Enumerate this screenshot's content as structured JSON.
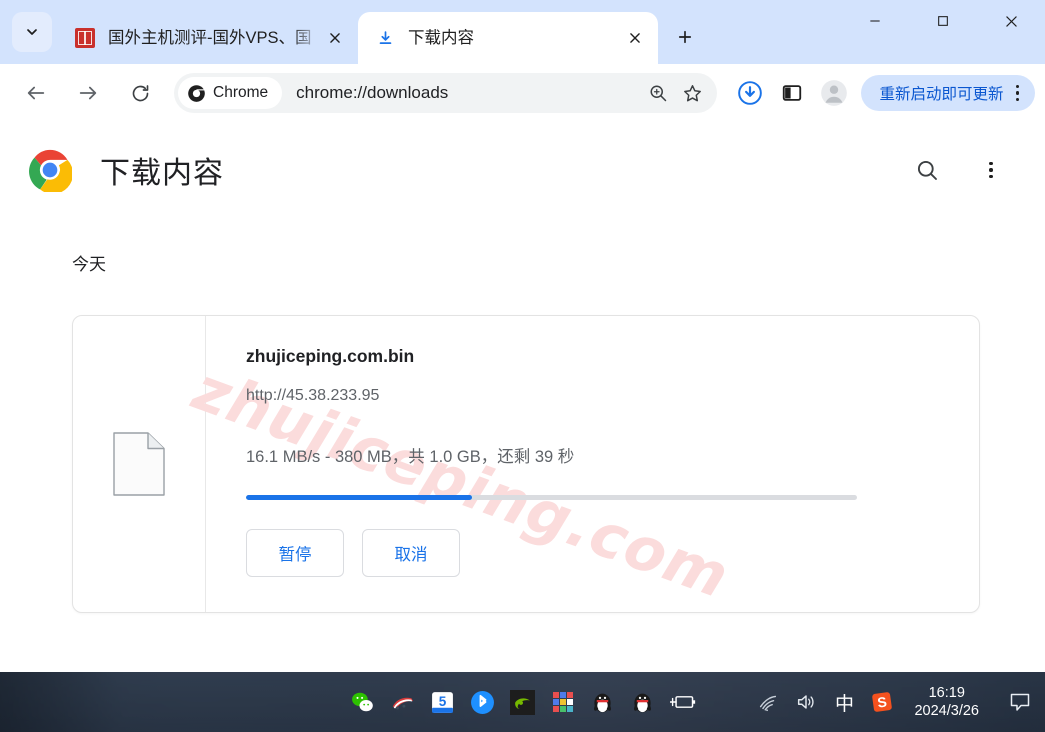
{
  "window": {
    "tabsearch_icon": "chevron-down-icon",
    "minimize_label": "—",
    "maximize_label": "□",
    "close_label": "✕",
    "newtab_label": "+"
  },
  "tabs": [
    {
      "title": "国外主机测评-国外VPS、国",
      "favicon": "red-stamp-favicon",
      "active": false,
      "close_label": "✕"
    },
    {
      "title": "下载内容",
      "favicon": "download-icon",
      "active": true,
      "close_label": "✕"
    }
  ],
  "toolbar": {
    "back_icon": "back-arrow-icon",
    "forward_icon": "forward-arrow-icon",
    "reload_icon": "reload-icon",
    "chrome_chip_label": "Chrome",
    "url": "chrome://downloads",
    "zoom_icon": "zoom-in-icon",
    "bookmark_icon": "star-icon",
    "downloads_icon": "downloads-ring-icon",
    "sidepanel_icon": "side-panel-icon",
    "profile_icon": "avatar-icon",
    "update_label": "重新启动即可更新",
    "menu_icon": "three-dot-menu-icon"
  },
  "page": {
    "logo": "chrome-logo",
    "title": "下载内容",
    "search_icon": "search-icon",
    "menu_icon": "three-dot-menu-icon",
    "group_label": "今天",
    "watermark": "zhujiceping.com"
  },
  "download": {
    "file_icon": "generic-file-icon",
    "file_name": "zhujiceping.com.bin",
    "url": "http://45.38.233.95",
    "status": "16.1 MB/s - 380 MB，共 1.0 GB，还剩 39 秒",
    "progress_percent": 37,
    "progress_fill_color": "#1a73e8",
    "pause_label": "暂停",
    "cancel_label": "取消"
  },
  "taskbar": {
    "apps": [
      {
        "name": "wechat-icon"
      },
      {
        "name": "train-ticket-icon"
      },
      {
        "name": "360-browser-icon",
        "label": "5"
      },
      {
        "name": "bluetooth-icon"
      },
      {
        "name": "nvidia-icon"
      },
      {
        "name": "color-squares-icon"
      },
      {
        "name": "qq-icon"
      },
      {
        "name": "qq-icon-2"
      },
      {
        "name": "battery-icon"
      }
    ],
    "tray": {
      "wifi_icon": "wifi-icon",
      "volume_icon": "volume-icon",
      "ime_label": "中",
      "sogou_label": "S",
      "time": "16:19",
      "date": "2024/3/26",
      "notification_icon": "notification-icon"
    }
  },
  "colors": {
    "tabstrip": "#d3e3fd",
    "accent_blue": "#1a73e8",
    "link_blue": "#0b57d0",
    "watermark_pink": "#fbdcdc"
  }
}
